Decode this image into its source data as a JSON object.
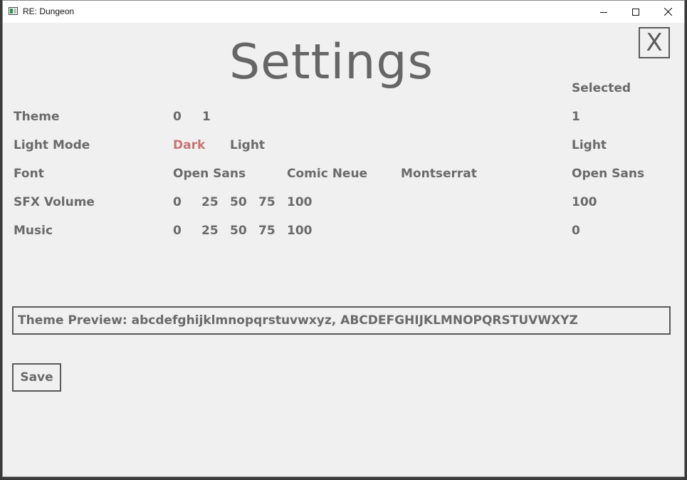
{
  "window": {
    "title": "RE: Dungeon"
  },
  "settings": {
    "title": "Settings",
    "close_label": "X",
    "selected_header": "Selected",
    "rows": {
      "theme": {
        "label": "Theme",
        "options": [
          "0",
          "1"
        ],
        "selected": "1"
      },
      "light_mode": {
        "label": "Light Mode",
        "options": [
          "Dark",
          "Light"
        ],
        "highlighted_option": "Dark",
        "selected": "Light"
      },
      "font": {
        "label": "Font",
        "options": [
          "Open Sans",
          "Comic Neue",
          "Montserrat"
        ],
        "selected": "Open Sans"
      },
      "sfx_volume": {
        "label": "SFX Volume",
        "options": [
          "0",
          "25",
          "50",
          "75",
          "100"
        ],
        "selected": "100"
      },
      "music": {
        "label": "Music",
        "options": [
          "0",
          "25",
          "50",
          "75",
          "100"
        ],
        "selected": "0"
      }
    },
    "preview_text": "Theme Preview: abcdefghijklmnopqrstuvwxyz, ABCDEFGHIJKLMNOPQRSTUVWXYZ",
    "save_label": "Save"
  },
  "colors": {
    "text": "#6a6a6a",
    "highlight": "#c87474",
    "border": "#5a5a5a",
    "background": "#f0f0f0"
  }
}
